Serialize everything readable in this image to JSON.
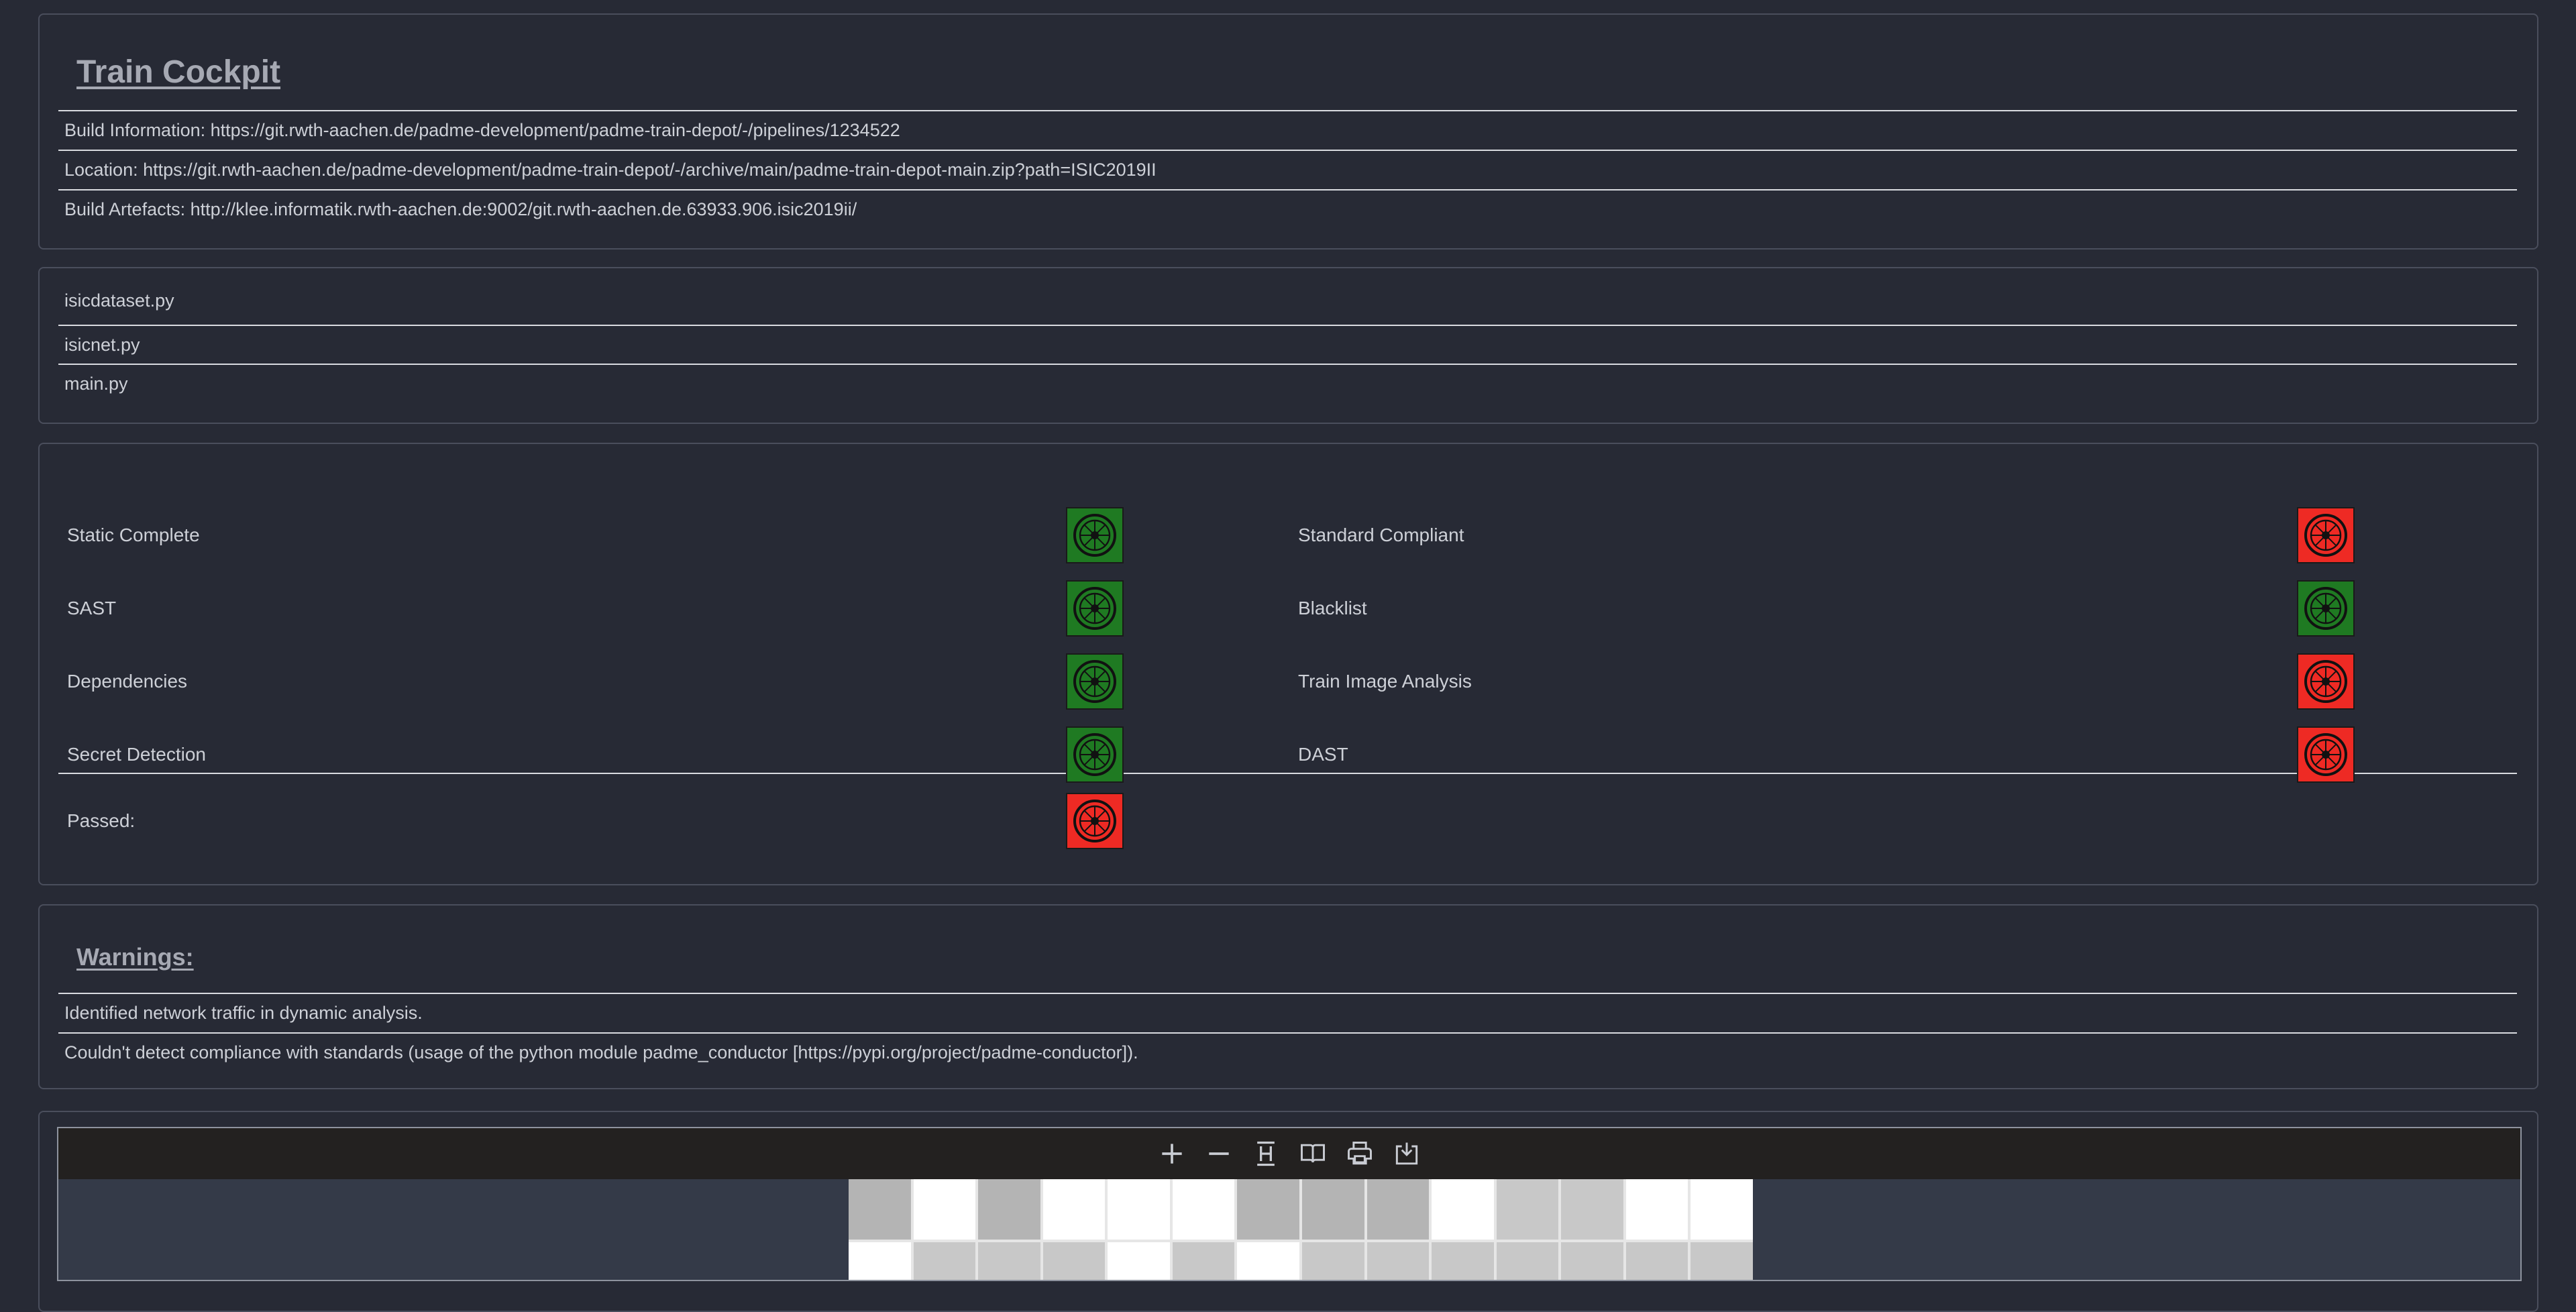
{
  "header": {
    "title": "Train Cockpit",
    "build_information": "Build Information: https://git.rwth-aachen.de/padme-development/padme-train-depot/-/pipelines/1234522",
    "location": "Location: https://git.rwth-aachen.de/padme-development/padme-train-depot/-/archive/main/padme-train-depot-main.zip?path=ISIC2019II",
    "build_artefacts": "Build Artefacts: http://klee.informatik.rwth-aachen.de:9002/git.rwth-aachen.de.63933.906.isic2019ii/"
  },
  "files": [
    "isicdataset.py",
    "isicnet.py",
    "main.py"
  ],
  "checks": {
    "left": [
      {
        "label": "Static Complete",
        "status": "green"
      },
      {
        "label": "SAST",
        "status": "green"
      },
      {
        "label": "Dependencies",
        "status": "green"
      },
      {
        "label": "Secret Detection",
        "status": "green"
      }
    ],
    "right": [
      {
        "label": "Standard Compliant",
        "status": "red"
      },
      {
        "label": "Blacklist",
        "status": "green"
      },
      {
        "label": "Train Image Analysis",
        "status": "red"
      },
      {
        "label": "DAST",
        "status": "red"
      }
    ],
    "passed": {
      "label": "Passed:",
      "status": "red"
    },
    "colors": {
      "green": "#1f7a22",
      "red": "#ee2a24"
    }
  },
  "warnings": {
    "title": "Warnings:",
    "items": [
      "Identified network traffic in dynamic analysis.",
      "Couldn't detect compliance with standards (usage of the python module padme_conductor [https://pypi.org/project/padme-conductor])."
    ]
  },
  "viewer": {
    "toolbar": [
      "zoom-in-icon",
      "zoom-out-icon",
      "fit-page-icon",
      "book-icon",
      "print-icon",
      "download-icon"
    ],
    "tile_rows": [
      [
        "g1",
        "w",
        "g1",
        "w",
        "w",
        "w",
        "g1",
        "g1",
        "g1",
        "w",
        "g2",
        "g2",
        "w",
        "w",
        "g2"
      ],
      [
        "w",
        "g2",
        "g2",
        "g2",
        "w",
        "g2",
        "w",
        "g2",
        "g2",
        "g2",
        "g2",
        "g2",
        "g2",
        "g2",
        "g2"
      ]
    ]
  }
}
